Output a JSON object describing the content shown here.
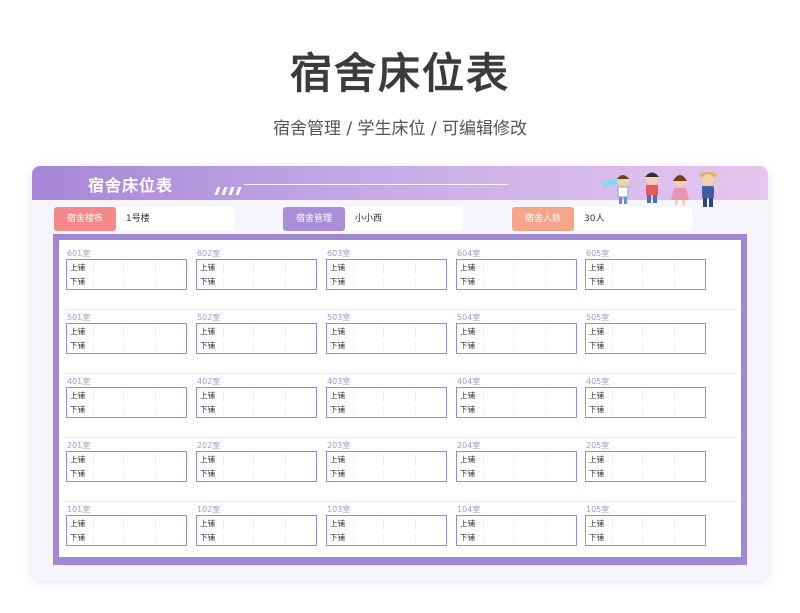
{
  "header": {
    "title": "宿舍床位表",
    "subtitle": "宿舍管理 / 学生床位 /  可编辑修改"
  },
  "sheet": {
    "banner_title": "宿舍床位表",
    "info": [
      {
        "label": "宿舍楼栋",
        "value": "1号楼",
        "color": "#f6878a"
      },
      {
        "label": "宿舍管理",
        "value": "小小西",
        "color": "#a98ed8"
      },
      {
        "label": "宿舍人数",
        "value": "30人",
        "color": "#f6a58a"
      }
    ],
    "bed_labels": {
      "upper": "上铺",
      "lower": "下铺"
    },
    "floors": [
      {
        "rooms": [
          "601室",
          "602室",
          "603室",
          "604室",
          "605室"
        ]
      },
      {
        "rooms": [
          "501室",
          "502室",
          "503室",
          "504室",
          "505室"
        ]
      },
      {
        "rooms": [
          "401室",
          "402室",
          "403室",
          "404室",
          "405室"
        ]
      },
      {
        "rooms": [
          "201室",
          "202室",
          "203室",
          "204室",
          "205室"
        ]
      },
      {
        "rooms": [
          "101室",
          "102室",
          "103室",
          "104室",
          "105室"
        ]
      }
    ]
  },
  "colors": {
    "accent": "#a287d3",
    "room_label": "#a897d6",
    "title_text": "#3b3b3b"
  }
}
